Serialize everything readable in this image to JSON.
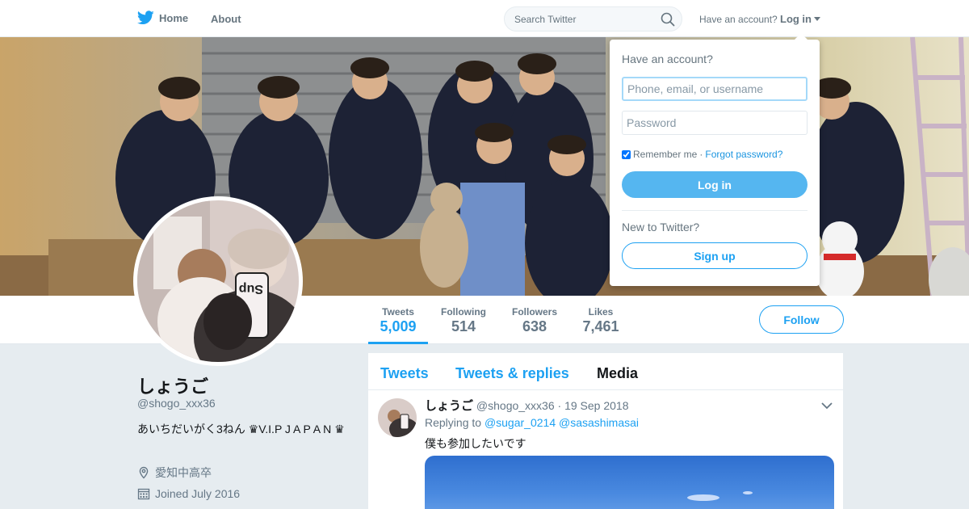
{
  "nav": {
    "home_label": "Home",
    "about_label": "About",
    "search_placeholder": "Search Twitter",
    "have_account": "Have an account?",
    "login_label": "Log in",
    "brand_color": "#1da1f2",
    "icons": {
      "logo": "twitter-bird-icon",
      "search": "magnifier-icon"
    }
  },
  "profile": {
    "name": "しょうご",
    "handle": "@shogo_xxx36",
    "bio": "あいちだいがく3ねん ♛V.I.P J A P A N ♛",
    "location": "愛知中高卒",
    "joined": "Joined July 2016",
    "icons": {
      "location": "map-pin-icon",
      "joined": "calendar-icon"
    }
  },
  "stats": [
    {
      "label": "Tweets",
      "value": "5,009",
      "active": true
    },
    {
      "label": "Following",
      "value": "514",
      "active": false
    },
    {
      "label": "Followers",
      "value": "638",
      "active": false
    },
    {
      "label": "Likes",
      "value": "7,461",
      "active": false
    }
  ],
  "follow_label": "Follow",
  "timeline": {
    "tabs": [
      {
        "label": "Tweets"
      },
      {
        "label": "Tweets & replies"
      },
      {
        "label": "Media",
        "current": true
      }
    ],
    "tweet": {
      "name": "しょうご",
      "handle": "@shogo_xxx36",
      "separator": "·",
      "date": "19 Sep 2018",
      "replying_to": "Replying to",
      "mentions": [
        "@sugar_0214",
        "@sasashimasai"
      ],
      "text": "僕も参加したいです"
    }
  },
  "login_dropdown": {
    "title": "Have an account?",
    "username_placeholder": "Phone, email, or username",
    "password_placeholder": "Password",
    "remember_label": "Remember me",
    "separator": "·",
    "forgot_label": "Forgot password?",
    "remember_checked": true,
    "login_button": "Log in",
    "new_label": "New to Twitter?",
    "signup_button": "Sign up"
  }
}
